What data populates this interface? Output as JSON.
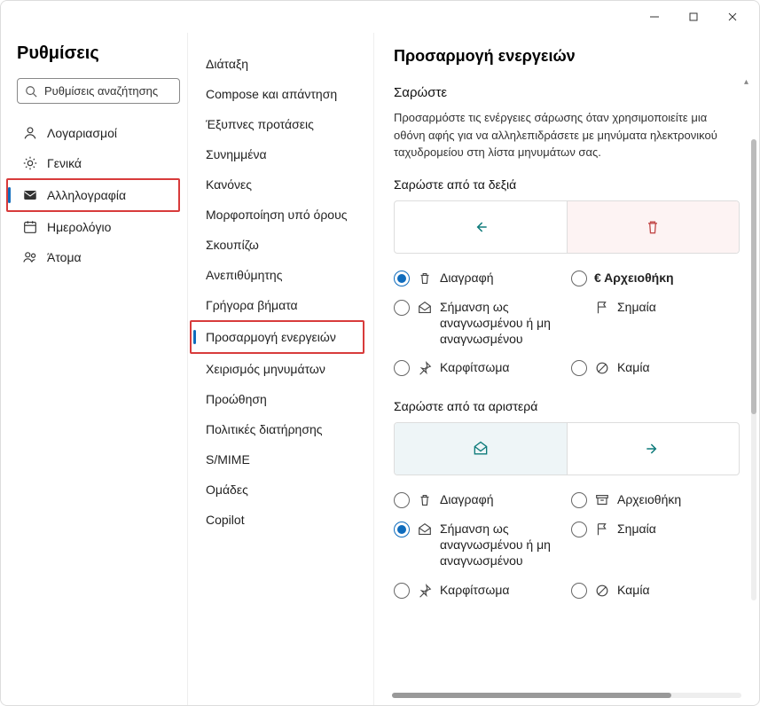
{
  "titlebar": {
    "min": "—",
    "max": "▢",
    "close": "✕"
  },
  "left": {
    "title": "Ρυθμίσεις",
    "searchPlaceholder": "Ρυθμίσεις αναζήτησης",
    "nav": [
      {
        "key": "accounts",
        "label": "Λογαριασμοί"
      },
      {
        "key": "general",
        "label": "Γενικά"
      },
      {
        "key": "mail",
        "label": "Αλληλογραφία"
      },
      {
        "key": "calendar",
        "label": "Ημερολόγιο"
      },
      {
        "key": "people",
        "label": "Άτομα"
      }
    ]
  },
  "mid": {
    "items": [
      "Διάταξη",
      "Compose και απάντηση",
      "Έξυπνες προτάσεις",
      "Συνημμένα",
      "Κανόνες",
      "Μορφοποίηση υπό όρους",
      "Σκουπίζω",
      "Ανεπιθύμητης",
      "Γρήγορα βήματα",
      "Προσαρμογή ενεργειών",
      "Χειρισμός μηνυμάτων",
      "Προώθηση",
      "Πολιτικές διατήρησης",
      "S/MIME",
      "Ομάδες",
      "Copilot"
    ]
  },
  "right": {
    "heading": "Προσαρμογή ενεργειών",
    "swipe": {
      "title": "Σαρώστε",
      "desc": "Προσαρμόστε τις ενέργειες σάρωσης όταν χρησιμοποιείτε μια οθόνη αφής για να αλληλεπιδράσετε με μηνύματα ηλεκτρονικού ταχυδρομείου στη λίστα μηνυμάτων σας.",
      "rightTitle": "Σαρώστε από τα δεξιά",
      "leftTitle": "Σαρώστε από τα αριστερά",
      "options": {
        "delete": "Διαγραφή",
        "archive": "Αρχειοθήκη",
        "markread": "Σήμανση ως αναγνωσμένου ή μη αναγνωσμένου",
        "flag": "Σημαία",
        "pin": "Καρφίτσωμα",
        "none": "Καμία",
        "archiveBold": "€  Αρχειοθήκη"
      }
    }
  }
}
